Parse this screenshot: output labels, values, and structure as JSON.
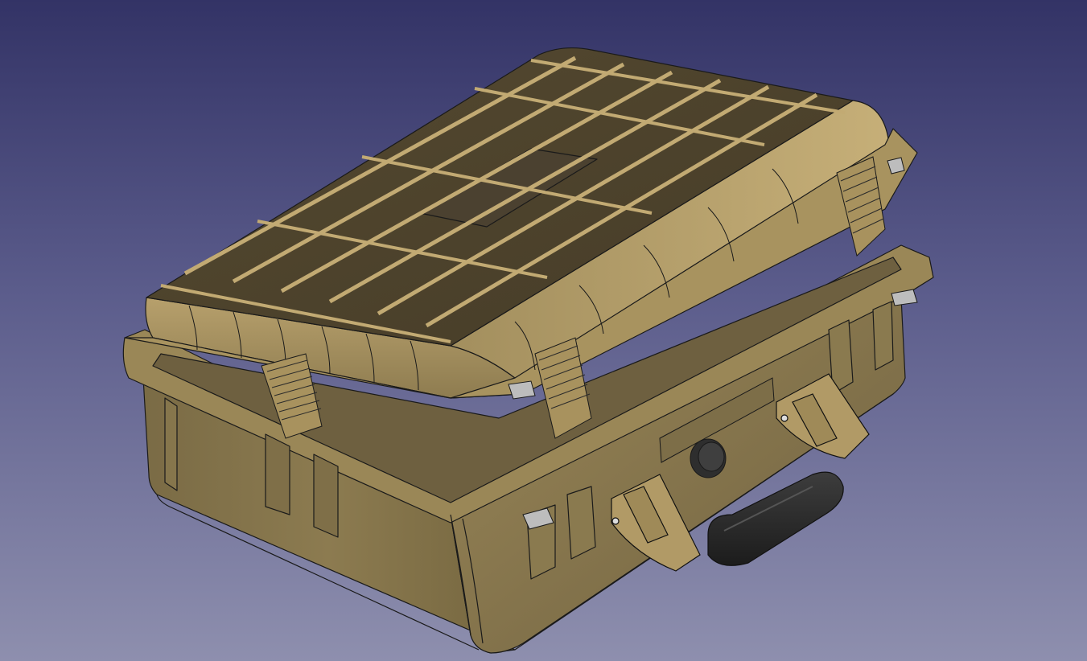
{
  "viewport": {
    "background_top": "#333366",
    "background_bottom": "#8e8fae"
  },
  "model": {
    "name": "hard-case",
    "body_color": "#8a7a52",
    "body_dark": "#6b5d3d",
    "lid_top_color": "#4e4430",
    "lid_light": "#c4ad78",
    "edge_color": "#1a1a1a",
    "handle_color": "#2a2a2a",
    "latch_color": "#b79e6a"
  }
}
